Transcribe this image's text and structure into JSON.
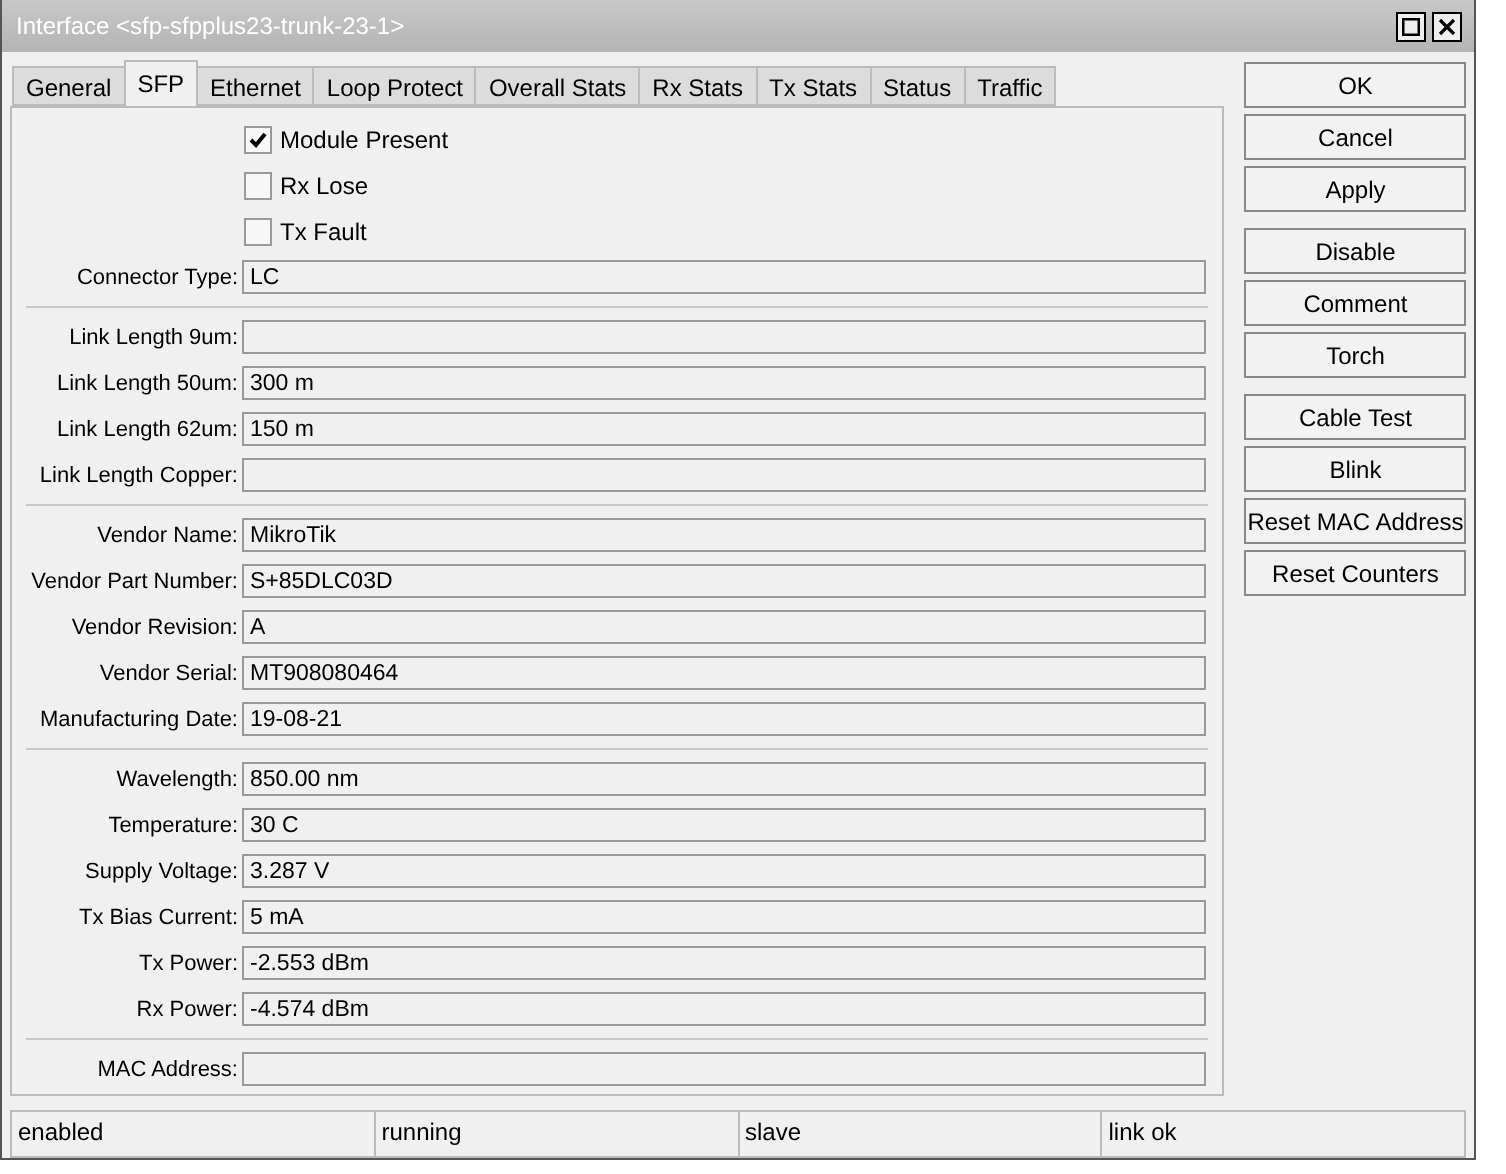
{
  "window": {
    "title": "Interface <sfp-sfpplus23-trunk-23-1>"
  },
  "tabs": [
    {
      "label": "General",
      "selected": false
    },
    {
      "label": "SFP",
      "selected": true
    },
    {
      "label": "Ethernet",
      "selected": false
    },
    {
      "label": "Loop Protect",
      "selected": false
    },
    {
      "label": "Overall Stats",
      "selected": false
    },
    {
      "label": "Rx Stats",
      "selected": false
    },
    {
      "label": "Tx Stats",
      "selected": false
    },
    {
      "label": "Status",
      "selected": false
    },
    {
      "label": "Traffic",
      "selected": false
    }
  ],
  "checkboxes": [
    {
      "label": "Module Present",
      "checked": true
    },
    {
      "label": "Rx Lose",
      "checked": false
    },
    {
      "label": "Tx Fault",
      "checked": false
    }
  ],
  "field_groups": [
    [
      {
        "label": "Connector Type:",
        "value": "LC"
      }
    ],
    [
      {
        "label": "Link Length 9um:"
      },
      {
        "label": "Link Length 50um:",
        "value": "300 m"
      },
      {
        "label": "Link Length 62um:",
        "value": "150 m"
      },
      {
        "label": "Link Length Copper:"
      }
    ],
    [
      {
        "label": "Vendor Name:",
        "value": "MikroTik"
      },
      {
        "label": "Vendor Part Number:",
        "value": "S+85DLC03D"
      },
      {
        "label": "Vendor Revision:",
        "value": "A"
      },
      {
        "label": "Vendor Serial:",
        "value": "MT908080464"
      },
      {
        "label": "Manufacturing Date:",
        "value": "19-08-21"
      }
    ],
    [
      {
        "label": "Wavelength:",
        "value": "850.00 nm"
      },
      {
        "label": "Temperature:",
        "value": "30 C"
      },
      {
        "label": "Supply Voltage:",
        "value": "3.287 V"
      },
      {
        "label": "Tx Bias Current:",
        "value": "5 mA"
      },
      {
        "label": "Tx Power:",
        "value": "-2.553 dBm"
      },
      {
        "label": "Rx Power:",
        "value": "-4.574 dBm"
      }
    ],
    [
      {
        "label": "MAC Address:"
      }
    ]
  ],
  "button_groups": [
    [
      "OK",
      "Cancel",
      "Apply"
    ],
    [
      "Disable",
      "Comment",
      "Torch"
    ],
    [
      "Cable Test",
      "Blink",
      "Reset MAC Address",
      "Reset Counters"
    ]
  ],
  "status_bar": [
    "enabled",
    "running",
    "slave",
    "link ok"
  ]
}
